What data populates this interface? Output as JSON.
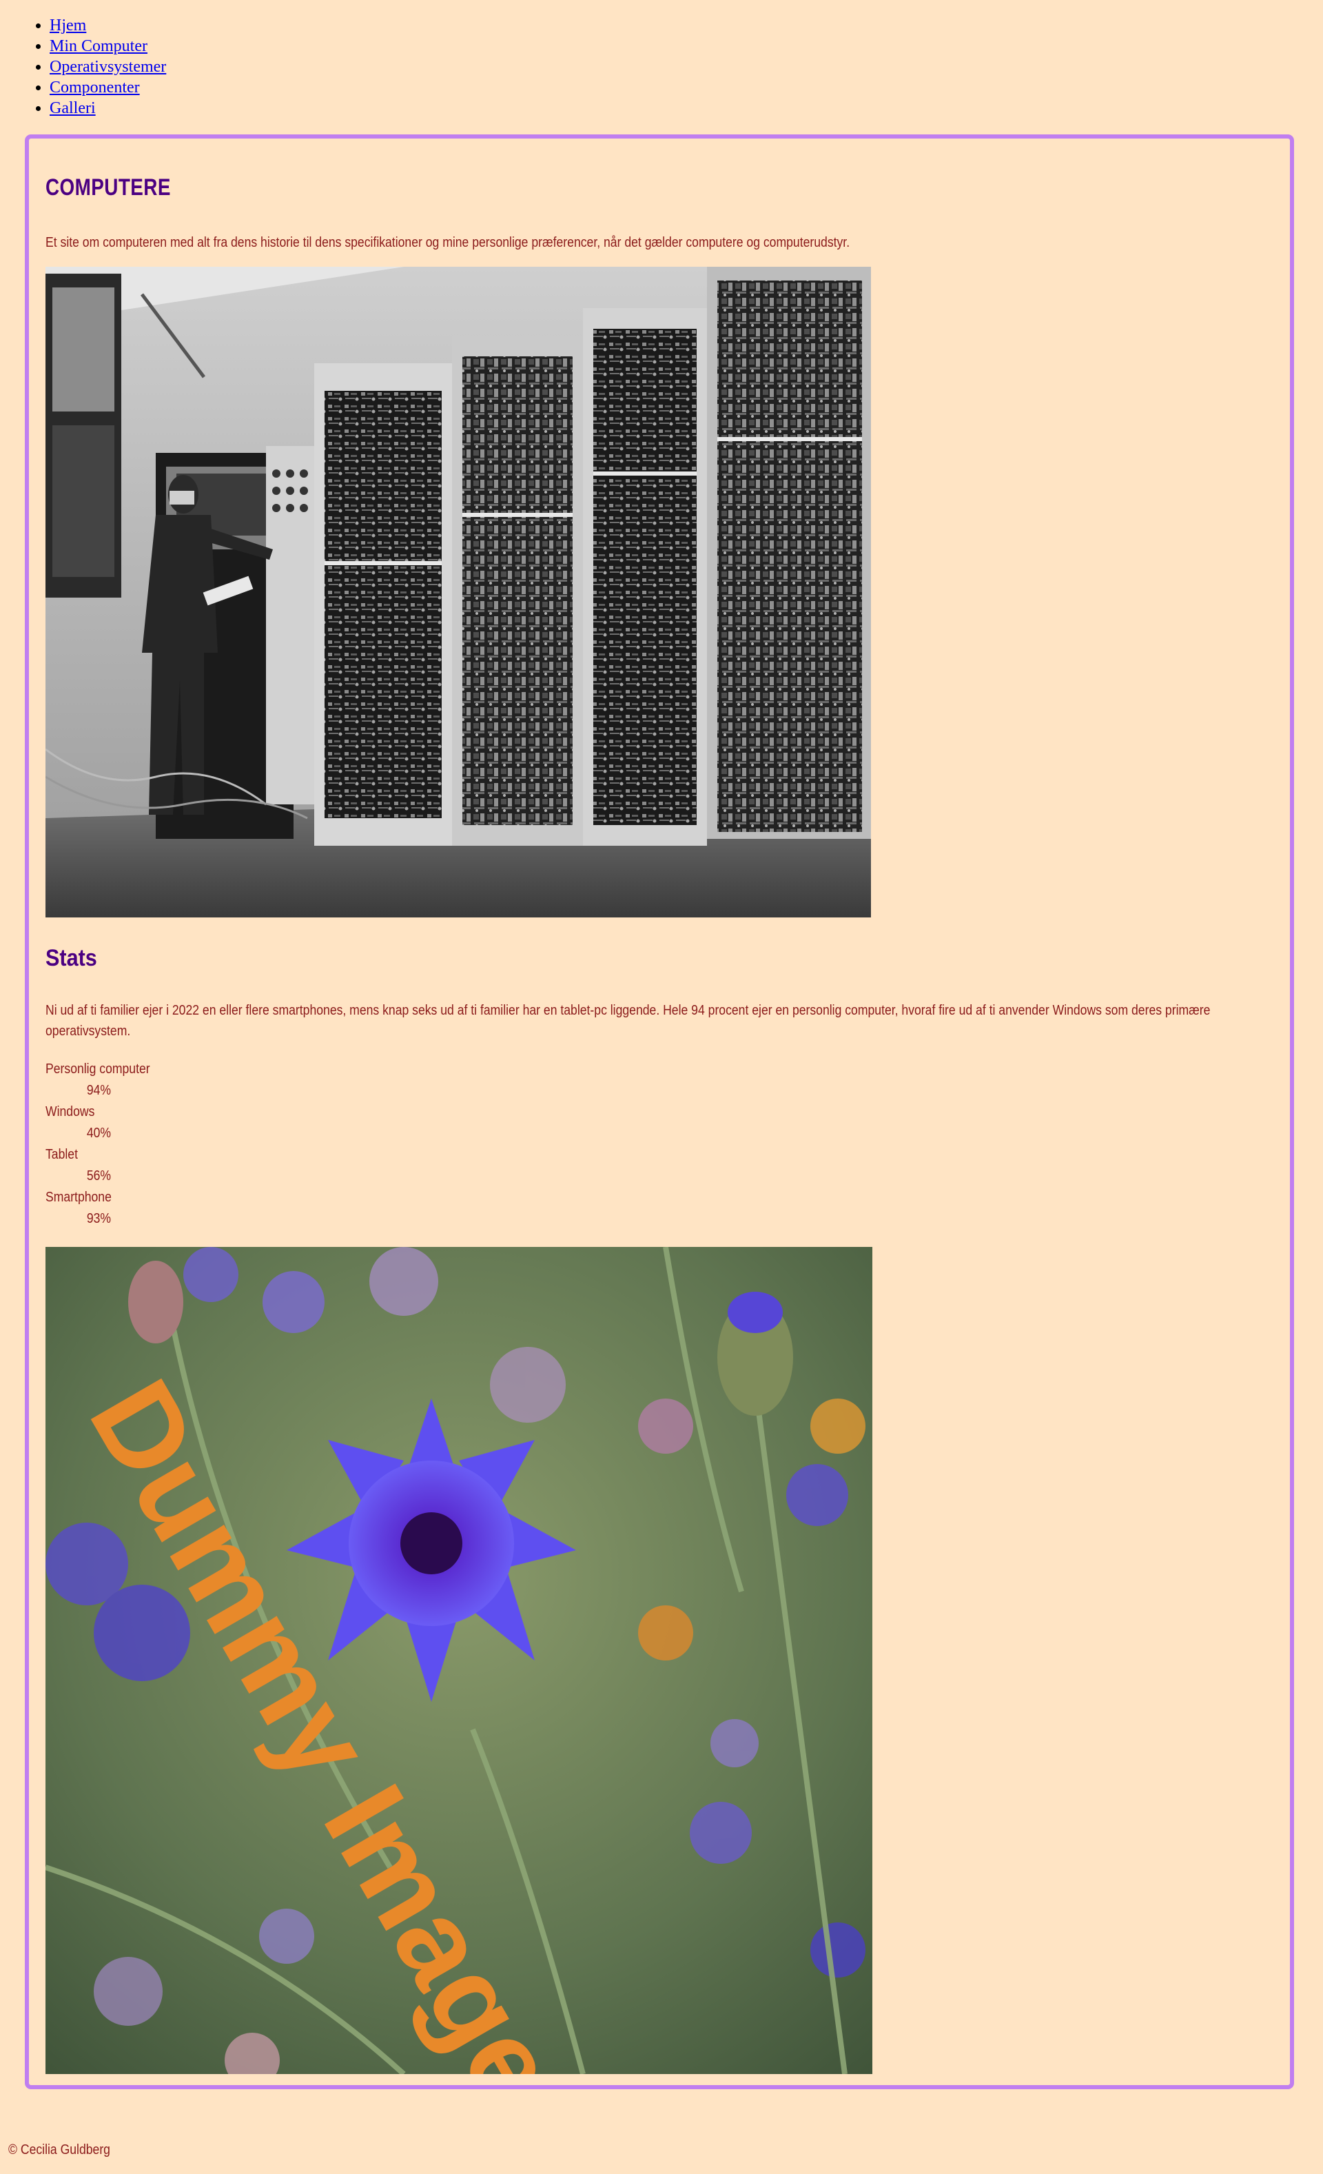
{
  "nav": {
    "items": [
      {
        "label": "Hjem"
      },
      {
        "label": "Min Computer"
      },
      {
        "label": "Operativsystemer"
      },
      {
        "label": "Componenter"
      },
      {
        "label": "Galleri"
      }
    ]
  },
  "main": {
    "title": "COMPUTERE",
    "intro": "Et site om computeren med alt fra dens historie til dens specifikationer og mine personlige præferencer, når det gælder computere og computerudstyr.",
    "stats_heading": "Stats",
    "stats_text": "Ni ud af ti familier ejer i 2022 en eller flere smartphones, mens knap seks ud af ti familier har en tablet-pc liggende. Hele 94 procent ejer en personlig computer, hvoraf fire ud af ti anvender Windows som deres primære operativsystem.",
    "stats": [
      {
        "term": "Personlig computer",
        "value": "94%"
      },
      {
        "term": "Windows",
        "value": "40%"
      },
      {
        "term": "Tablet",
        "value": "56%"
      },
      {
        "term": "Smartphone",
        "value": "93%"
      }
    ],
    "dummy_image_text": "Dummy Image"
  },
  "footer": {
    "text": "© Cecilia Guldberg"
  },
  "colors": {
    "background": "#ffe4c4",
    "frame": "#c07ef0",
    "heading": "#4b0082",
    "text": "#8b1a1a",
    "link": "#0000ee",
    "dummy_text": "#e8892a"
  }
}
